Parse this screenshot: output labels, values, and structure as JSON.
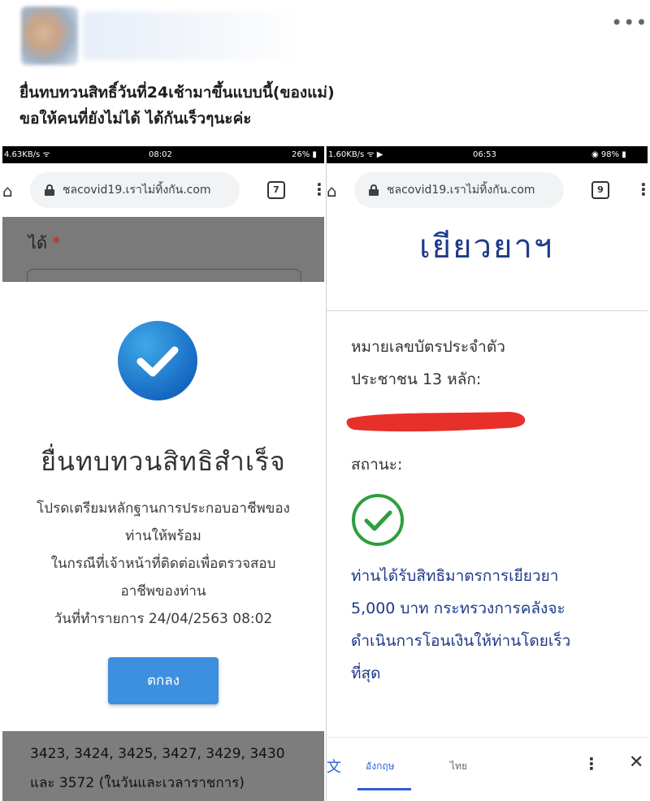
{
  "post": {
    "more_icon": "•••",
    "text_line1": "ยื่นทบทวนสิทธิ์วันที่24เช้ามาขึ้นแบบนี้(ของแม่)",
    "text_line2": "ขอให้คนที่ยังไม่ได้ ได้กันเร็วๆนะค่ะ"
  },
  "left_screen": {
    "status": {
      "speed": "4.63KB/s ᯤ",
      "time": "08:02",
      "battery": "26% ▮"
    },
    "url": "ชลcovid19.เราไม่ทิ้งกัน.com",
    "tab_count": "7",
    "menu_icon": "⋮",
    "home_icon": "⌂",
    "field_label": "ได้",
    "required_mark": "*",
    "success_title": "ยื่นทบทวนสิทธิสำเร็จ",
    "desc_line1": "โปรดเตรียมหลักฐานการประกอบอาชีพของ",
    "desc_line2": "ท่านให้พร้อม",
    "desc_line3": "ในกรณีที่เจ้าหน้าที่ติดต่อเพื่อตรวจสอบ",
    "desc_line4": "อาชีพของท่าน",
    "desc_line5": "วันที่ทำรายการ 24/04/2563 08:02",
    "ok_label": "ตกลง",
    "bottom_line1": "3423, 3424, 3425, 3427, 3429, 3430",
    "bottom_line2": "และ 3572 (ในวันและเวลาราชการ)"
  },
  "right_screen": {
    "status": {
      "speed": "1.60KB/s ᯤ ▶",
      "time": "06:53",
      "battery": "◉ 98% ▮"
    },
    "url": "ชลcovid19.เราไม่ทิ้งกัน.com",
    "tab_count": "9",
    "menu_icon": "⋮",
    "home_icon": "⌂",
    "heading": "เยียวยาฯ",
    "id_label_line1": "หมายเลขบัตรประจำตัว",
    "id_label_line2": "ประชาชน 13 หลัก:",
    "status_label": "สถานะ:",
    "result_line1": "ท่านได้รับสิทธิมาตรการเยียวยา",
    "result_line2": "5,000 บาท กระทรวงการคลังจะ",
    "result_line3": "ดำเนินการโอนเงินให้ท่านโดยเร็ว",
    "result_line4": "ที่สุด",
    "bottom_tab1": "อังกฤษ",
    "bottom_tab2": "ไทย",
    "bottom_menu_icon": "⋮",
    "bottom_close_icon": "✕",
    "translate_icon": "文"
  },
  "colors": {
    "success_blue": "#1976d2",
    "heading_navy": "#1e3a8a",
    "check_green": "#2e9e3e",
    "redact_red": "#e8302a",
    "ok_button": "#3d8fe0"
  }
}
